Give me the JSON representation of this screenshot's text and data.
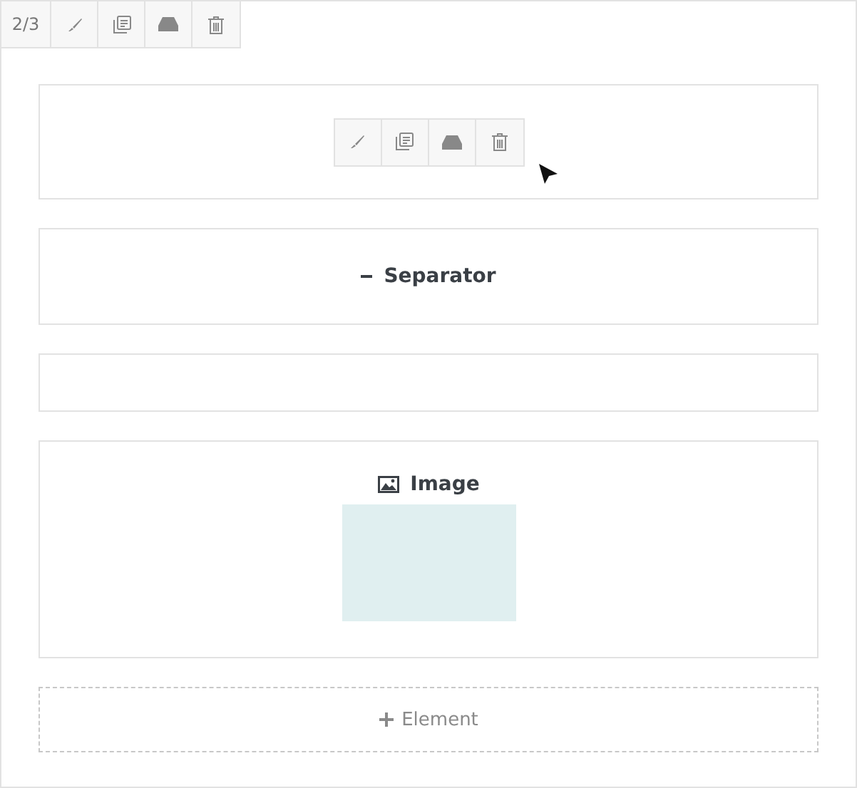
{
  "toolbar": {
    "counter": "2/3",
    "buttons": [
      {
        "kind": "edit"
      },
      {
        "kind": "duplicate"
      },
      {
        "kind": "save"
      },
      {
        "kind": "delete"
      }
    ]
  },
  "blocks": [
    {
      "kind": "toolbar",
      "buttons": [
        {
          "kind": "edit"
        },
        {
          "kind": "duplicate"
        },
        {
          "kind": "save"
        },
        {
          "kind": "delete"
        }
      ]
    },
    {
      "kind": "separator",
      "title": "Separator"
    },
    {
      "kind": "empty"
    },
    {
      "kind": "image",
      "title": "Image"
    }
  ],
  "add_button": {
    "label": "Element"
  }
}
